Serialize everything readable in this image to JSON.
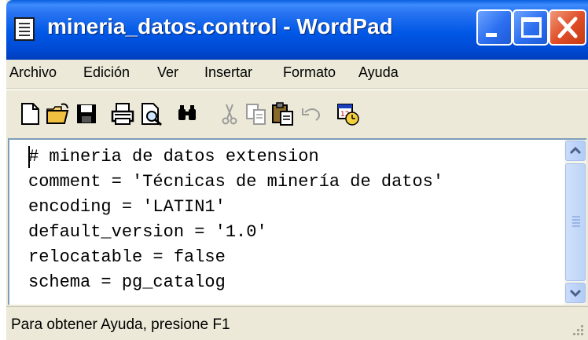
{
  "window": {
    "title": "mineria_datos.control - WordPad",
    "accent_color": "#0058e6",
    "close_color": "#e0502a"
  },
  "titlebar_buttons": {
    "minimize_icon": "minimize-icon",
    "maximize_icon": "maximize-icon",
    "close_icon": "close-icon"
  },
  "menu": {
    "items": [
      "Archivo",
      "Edición",
      "Ver",
      "Insertar",
      "Formato",
      "Ayuda"
    ]
  },
  "toolbar": {
    "icons": [
      "new-document-icon",
      "open-folder-icon",
      "save-icon",
      "print-icon",
      "print-preview-icon",
      "find-icon",
      "cut-icon",
      "copy-icon",
      "paste-icon",
      "undo-icon",
      "insert-datetime-icon"
    ]
  },
  "document": {
    "lines": [
      "# mineria de datos extension",
      "comment = 'Técnicas de minería de datos'",
      "encoding = 'LATIN1'",
      "default_version = '1.0'",
      "relocatable = false",
      "schema = pg_catalog"
    ]
  },
  "status": {
    "text": "Para obtener Ayuda, presione F1"
  }
}
